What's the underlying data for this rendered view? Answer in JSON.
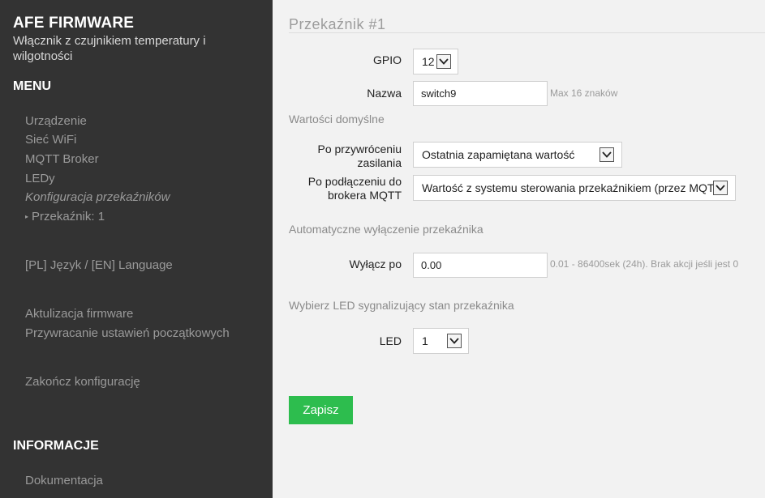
{
  "sidebar": {
    "brand_title": "AFE FIRMWARE",
    "brand_subtitle": "Włącznik z czujnikiem temperatury i wilgotności",
    "menu_heading": "MENU",
    "menu_items": {
      "device": "Urządzenie",
      "wifi": "Sieć WiFi",
      "mqtt": "MQTT Broker",
      "leds": "LEDy",
      "relays_config": "Konfiguracja przekaźników",
      "relay_1": "Przekaźnik: 1",
      "language": "[PL] Język / [EN] Language",
      "firmware_update": "Aktulizacja firmware",
      "factory_reset": "Przywracanie ustawień początkowych",
      "finish": "Zakończ konfigurację"
    },
    "info_heading": "INFORMACJE",
    "info_items": {
      "docs": "Dokumentacja"
    }
  },
  "main": {
    "title": "Przekaźnik #1",
    "gpio": {
      "label": "GPIO",
      "value": "12"
    },
    "name": {
      "label": "Nazwa",
      "value": "switch9",
      "hint": "Max 16 znaków"
    },
    "defaults_heading": "Wartości domyślne",
    "power_restore": {
      "label": "Po przywróceniu zasilania",
      "value": "Ostatnia zapamiętana wartość"
    },
    "broker_connect": {
      "label": "Po podłączeniu do brokera MQTT",
      "value": "Wartość z systemu sterowania przekaźnikiem (przez MQTT)"
    },
    "auto_off_heading": "Automatyczne wyłączenie przekaźnika",
    "off_after": {
      "label": "Wyłącz po",
      "value": "0.00",
      "hint": "0.01 - 86400sek (24h). Brak akcji jeśli jest 0"
    },
    "led_heading": "Wybierz LED sygnalizujący stan przekaźnika",
    "led": {
      "label": "LED",
      "value": "1"
    },
    "save_label": "Zapisz"
  },
  "colors": {
    "sidebar_bg": "#333333",
    "main_bg": "#f2f2f2",
    "accent_green": "#2dbd4e"
  }
}
